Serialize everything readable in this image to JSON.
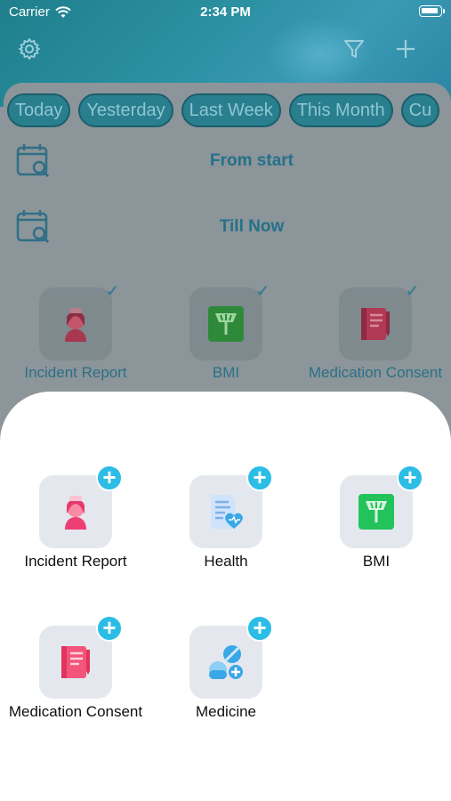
{
  "status_bar": {
    "carrier": "Carrier",
    "time": "2:34 PM"
  },
  "filters": {
    "chips": [
      "Today",
      "Yesterday",
      "Last Week",
      "This Month",
      "Cu"
    ],
    "from_label": "From start",
    "till_label": "Till Now"
  },
  "selected_forms": [
    {
      "label": "Incident Report",
      "icon": "nurse-icon"
    },
    {
      "label": "BMI",
      "icon": "scale-icon"
    },
    {
      "label": "Medication Consent",
      "icon": "notebook-icon"
    }
  ],
  "sheet": {
    "items": [
      {
        "label": "Incident Report",
        "icon": "nurse-icon"
      },
      {
        "label": "Health",
        "icon": "health-document-icon"
      },
      {
        "label": "BMI",
        "icon": "scale-icon"
      },
      {
        "label": "Medication Consent",
        "icon": "notebook-icon"
      },
      {
        "label": "Medicine",
        "icon": "pills-icon"
      }
    ]
  },
  "colors": {
    "accent": "#2bbde6",
    "header": "#2a8fa0",
    "chip_bg": "#2a7f8f"
  }
}
